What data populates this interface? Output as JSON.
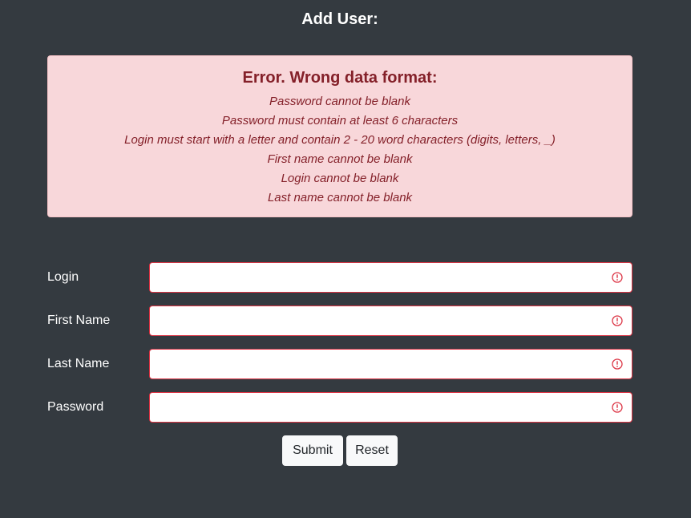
{
  "page": {
    "title": "Add User:"
  },
  "alert": {
    "heading": "Error. Wrong data format:",
    "messages": [
      "Password cannot be blank",
      "Password must contain at least 6 characters",
      "Login must start with a letter and contain 2 - 20 word characters (digits, letters, _)",
      "First name cannot be blank",
      "Login cannot be blank",
      "Last name cannot be blank"
    ]
  },
  "form": {
    "fields": [
      {
        "label": "Login",
        "value": ""
      },
      {
        "label": "First Name",
        "value": ""
      },
      {
        "label": "Last Name",
        "value": ""
      },
      {
        "label": "Password",
        "value": ""
      }
    ],
    "submit_label": "Submit",
    "reset_label": "Reset"
  },
  "icons": {
    "field_error": "exclamation-circle-icon"
  },
  "colors": {
    "background": "#343a40",
    "alert_bg": "#f8d7da",
    "alert_text": "#842029",
    "invalid_border": "#dc3545",
    "button_bg": "#f8f9fa"
  }
}
